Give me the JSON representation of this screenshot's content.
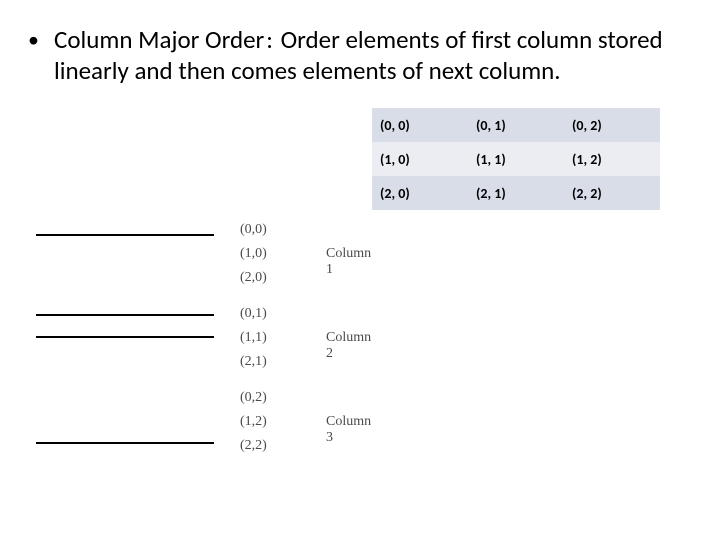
{
  "bullet": {
    "term": "Column Major Order",
    "colon": ":",
    "definition": "Order elements of first column stored linearly and then comes elements of next column."
  },
  "grid": {
    "rows": [
      [
        "(0, 0)",
        "(0, 1)",
        "(0, 2)"
      ],
      [
        "(1, 0)",
        "(1, 1)",
        "(1, 2)"
      ],
      [
        "(2, 0)",
        "(2, 1)",
        "(2, 2)"
      ]
    ]
  },
  "linear": {
    "segments": [
      {
        "label": "Column 1",
        "cells": [
          "(0,0)",
          "(1,0)",
          "(2,0)"
        ]
      },
      {
        "label": "Column 2",
        "cells": [
          "(0,1)",
          "(1,1)",
          "(2,1)"
        ]
      },
      {
        "label": "Column 3",
        "cells": [
          "(0,2)",
          "(1,2)",
          "(2,2)"
        ]
      }
    ]
  }
}
